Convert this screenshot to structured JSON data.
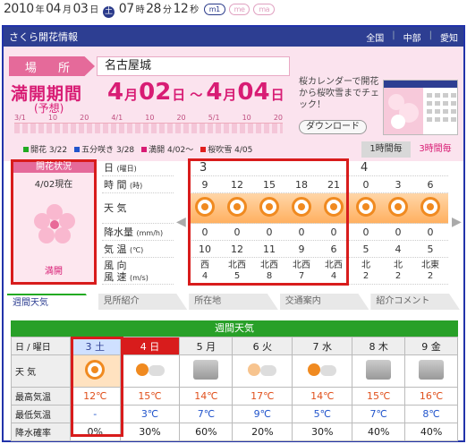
{
  "date": {
    "year": "2010",
    "y_unit": "年",
    "month": "04",
    "m_unit": "月",
    "day": "03",
    "d_unit": "日",
    "dow": "土",
    "hour": "07",
    "h_unit": "時",
    "min": "28",
    "mi_unit": "分",
    "sec": "12",
    "s_unit": "秒",
    "pills": [
      "m1",
      "me",
      "ma"
    ]
  },
  "title": "さくら開花情報",
  "nav": [
    "全国",
    "中部",
    "愛知"
  ],
  "place": {
    "label": "場 所",
    "value": "名古屋城"
  },
  "bloom": {
    "heading": "満開期間",
    "note": "(予想)",
    "m1": "4",
    "u_month1": "月",
    "d1": "02",
    "u_day1": "日",
    "tilde": "～",
    "m2": "4",
    "u_month2": "月",
    "d2": "04",
    "u_day2": "日"
  },
  "calendar": {
    "note": "桜カレンダーで開花から桜吹雪までチェック！",
    "button": "ダウンロード"
  },
  "timeline": [
    "3/1",
    "10",
    "20",
    "4/1",
    "10",
    "20",
    "5/1",
    "10",
    "20"
  ],
  "legend": [
    {
      "text": "開花 3/22",
      "color": "#22aa22"
    },
    {
      "text": "五分咲き 3/28",
      "color": "#2255cc"
    },
    {
      "text": "満開 4/02〜",
      "color": "#d81c74"
    },
    {
      "text": "桜吹雪 4/05",
      "color": "#e02020"
    }
  ],
  "tab_hour": [
    "1時間毎",
    "3時間毎"
  ],
  "status": {
    "head": "開花状況",
    "date": "4/02現在",
    "state": "満開"
  },
  "row_labels": {
    "day": "日",
    "day_s": "(曜日)",
    "time": "時 間",
    "time_s": "(時)",
    "weather": "天 気",
    "rain": "降水量",
    "rain_s": "(mm/h)",
    "temp": "気 温",
    "temp_s": "(℃)",
    "wind1": "風 向",
    "wind2": "風 速",
    "wind_s": "(m/s)"
  },
  "hourly": {
    "days": [
      "3",
      "",
      "",
      "",
      "",
      "4",
      "",
      ""
    ],
    "times": [
      "9",
      "12",
      "15",
      "18",
      "21",
      "0",
      "3",
      "6"
    ],
    "rain": [
      "0",
      "0",
      "0",
      "0",
      "0",
      "0",
      "0",
      "0"
    ],
    "temp": [
      "10",
      "12",
      "11",
      "9",
      "6",
      "5",
      "4",
      "5"
    ],
    "wind_dir": [
      "西",
      "北西",
      "北西",
      "北西",
      "北西",
      "北",
      "北",
      "北東"
    ],
    "wind_speed": [
      "4",
      "5",
      "8",
      "7",
      "4",
      "2",
      "2",
      "2"
    ]
  },
  "tabs": [
    "週間天気",
    "見所紹介",
    "所在地",
    "交通案内",
    "紹介コメント"
  ],
  "week": {
    "title": "週間天気",
    "labels": {
      "day": "日 / 曜日",
      "weather": "天 気",
      "high": "最高気温",
      "low": "最低気温",
      "pop": "降水確率"
    },
    "days": [
      "3 土",
      "4 日",
      "5 月",
      "6 火",
      "7 水",
      "8 木",
      "9 金"
    ],
    "high": [
      "12℃",
      "15℃",
      "14℃",
      "17℃",
      "14℃",
      "15℃",
      "16℃"
    ],
    "low": [
      "-",
      "3℃",
      "7℃",
      "9℃",
      "5℃",
      "7℃",
      "8℃"
    ],
    "pop": [
      "0%",
      "30%",
      "60%",
      "20%",
      "30%",
      "40%",
      "40%"
    ],
    "icons": [
      "sun-icon",
      "sun-cloud-icon",
      "cloud-rain-icon",
      "cloud-icon",
      "sun-cloud-icon",
      "cloud-icon",
      "cloud-icon"
    ]
  },
  "colors": {
    "accent": "#2d3e92",
    "pink": "#d81c74",
    "highlight": "#d81c1c",
    "green": "#28a028"
  }
}
